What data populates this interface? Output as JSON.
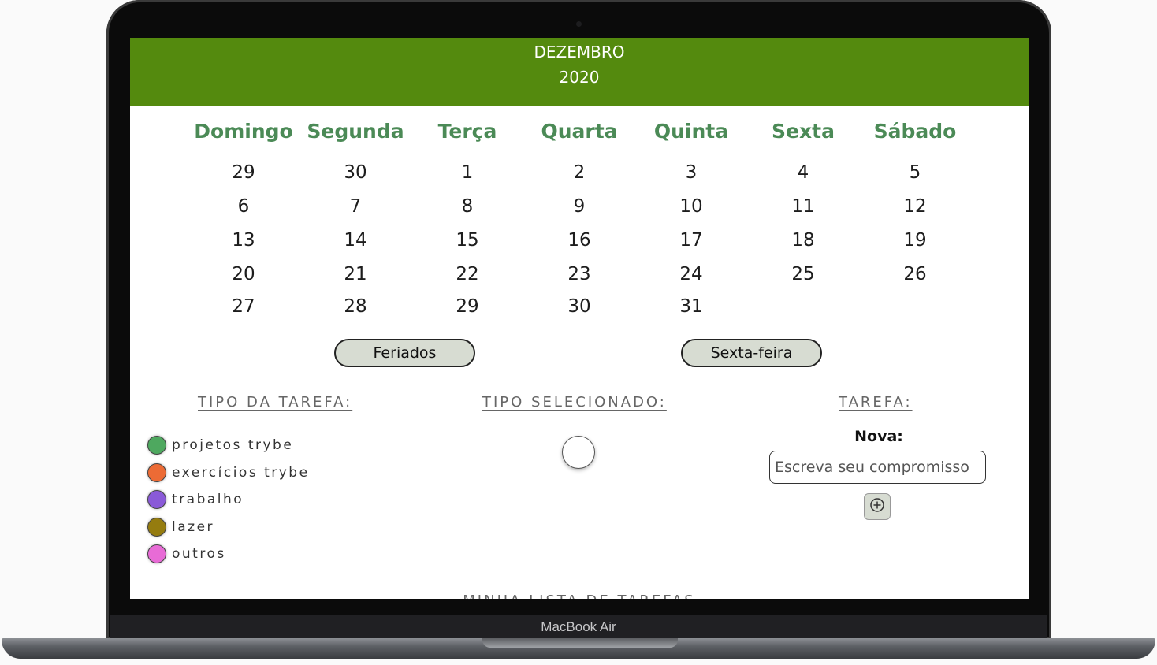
{
  "header": {
    "month": "DEZEMBRO",
    "year": "2020"
  },
  "calendar": {
    "weekdays": [
      "Domingo",
      "Segunda",
      "Terça",
      "Quarta",
      "Quinta",
      "Sexta",
      "Sábado"
    ],
    "weeks": [
      [
        "29",
        "30",
        "1",
        "2",
        "3",
        "4",
        "5"
      ],
      [
        "6",
        "7",
        "8",
        "9",
        "10",
        "11",
        "12"
      ],
      [
        "13",
        "14",
        "15",
        "16",
        "17",
        "18",
        "19"
      ],
      [
        "20",
        "21",
        "22",
        "23",
        "24",
        "25",
        "26"
      ],
      [
        "27",
        "28",
        "29",
        "30",
        "31",
        "",
        ""
      ]
    ]
  },
  "buttons": {
    "holidays": "Feriados",
    "friday": "Sexta-feira"
  },
  "sections": {
    "task_type_title": "TIPO DA TAREFA:",
    "selected_type_title": "TIPO SELECIONADO:",
    "task_title": "TAREFA:",
    "task_list_title": "MINHA LISTA DE TAREFAS"
  },
  "task_types": [
    {
      "label": "projetos trybe",
      "color": "#4ea85f"
    },
    {
      "label": "exercícios trybe",
      "color": "#ec6b35"
    },
    {
      "label": "trabalho",
      "color": "#8a5ad8"
    },
    {
      "label": "lazer",
      "color": "#957c0f"
    },
    {
      "label": "outros",
      "color": "#e86bd6"
    }
  ],
  "selected_type": {
    "color": "#ffffff"
  },
  "task_form": {
    "new_label": "Nova:",
    "input_placeholder": "Escreva seu compromisso",
    "add_icon": "plus-circle-icon"
  },
  "device": {
    "label": "MacBook Air"
  },
  "colors": {
    "header_bg": "#548a0e",
    "weekday_text": "#4b8a56",
    "button_bg": "#d7dcd2"
  }
}
